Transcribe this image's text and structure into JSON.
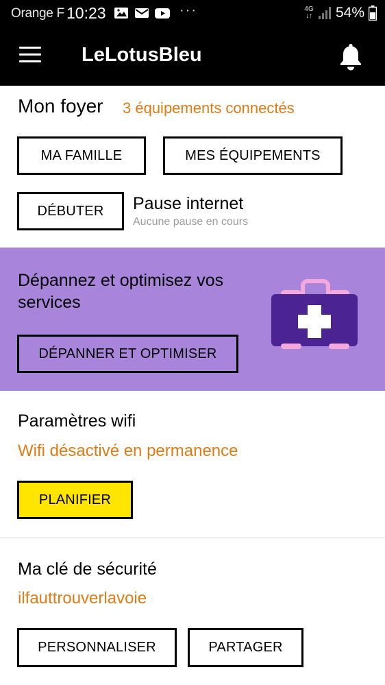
{
  "status_bar": {
    "carrier": "Orange F",
    "time": "10:23",
    "more": "···",
    "network": "4G",
    "battery": "54%",
    "icons": [
      "image-icon",
      "mail-icon",
      "youtube-icon",
      "signal-icon",
      "battery-icon"
    ]
  },
  "app_bar": {
    "title": "LeLotusBleu",
    "icons": [
      "menu-icon",
      "bell-icon"
    ]
  },
  "foyer": {
    "title": "Mon foyer",
    "connected": "3 équipements connectés",
    "family_label": "MA FAMILLE",
    "devices_label": "MES ÉQUIPEMENTS",
    "start_label": "DÉBUTER",
    "pause_title": "Pause internet",
    "pause_status": "Aucune pause en cours"
  },
  "troubleshoot": {
    "title": "Dépannez et optimisez vos services",
    "button_label": "DÉPANNER ET OPTIMISER",
    "icon": "first-aid-kit-icon",
    "bg_color": "#a885db"
  },
  "wifi": {
    "title": "Paramètres wifi",
    "status": "Wifi désactivé en permanence",
    "plan_label": "PLANIFIER",
    "plan_color": "#ffe500"
  },
  "security": {
    "title": "Ma clé de sécurité",
    "key": "ilfauttrouverlavoie",
    "customize_label": "PERSONNALISER",
    "share_label": "PARTAGER"
  },
  "colors": {
    "accent": "#e07b15",
    "header": "#000000"
  }
}
